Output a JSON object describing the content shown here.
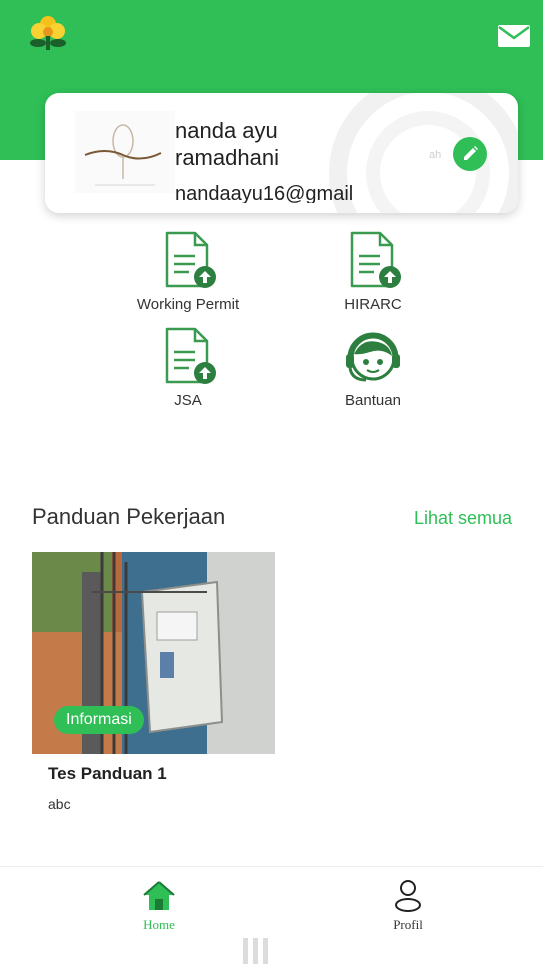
{
  "header": {
    "logo_icon": "flower-logo-icon",
    "mail_icon": "mail-icon",
    "accent_color": "#2fbf56"
  },
  "profile": {
    "name": "nanda ayu ramadhani",
    "email": "nandaayu16@gmail",
    "extra_text": "ah",
    "edit_icon": "pencil-icon"
  },
  "menu": [
    {
      "label": "Working Permit",
      "icon": "document-upload-icon"
    },
    {
      "label": "HIRARC",
      "icon": "document-upload-icon"
    },
    {
      "label": "JSA",
      "icon": "document-upload-icon"
    },
    {
      "label": "Bantuan",
      "icon": "headset-support-icon"
    }
  ],
  "guides": {
    "title": "Panduan Pekerjaan",
    "see_all_label": "Lihat semua",
    "items": [
      {
        "badge": "Informasi",
        "title": "Tes Panduan 1",
        "description": "abc"
      }
    ]
  },
  "bottom_nav": {
    "items": [
      {
        "label": "Home",
        "icon": "home-icon",
        "active": true
      },
      {
        "label": "Profil",
        "icon": "user-icon",
        "active": false
      }
    ]
  }
}
